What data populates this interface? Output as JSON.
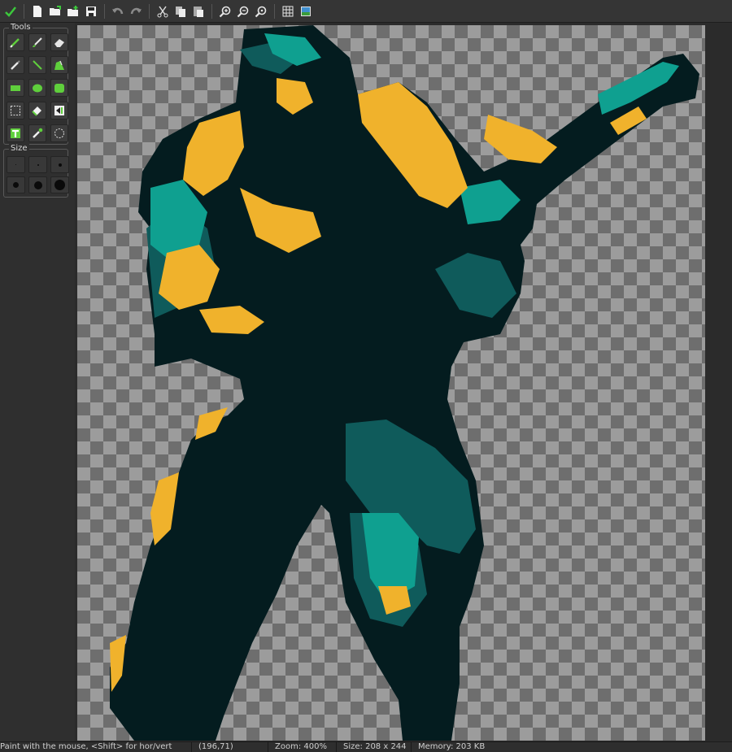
{
  "toolbar": {
    "buttons": [
      {
        "name": "apply-icon"
      },
      {
        "name": "new-file-icon"
      },
      {
        "name": "open-file-icon"
      },
      {
        "name": "open-recent-icon"
      },
      {
        "name": "save-icon"
      },
      {
        "name": "undo-icon"
      },
      {
        "name": "redo-icon"
      },
      {
        "name": "cut-icon"
      },
      {
        "name": "copy-icon"
      },
      {
        "name": "paste-icon"
      },
      {
        "name": "zoom-in-icon"
      },
      {
        "name": "zoom-out-icon"
      },
      {
        "name": "zoom-reset-icon"
      },
      {
        "name": "grid-icon"
      },
      {
        "name": "preview-icon"
      }
    ]
  },
  "tools_panel": {
    "title": "Tools",
    "tools": [
      "pencil",
      "brush",
      "eraser",
      "pen",
      "line",
      "fill",
      "rectangle",
      "ellipse",
      "rounded-rectangle",
      "select",
      "color-picker",
      "flip",
      "text",
      "dropper",
      "lasso"
    ]
  },
  "size_panel": {
    "title": "Size"
  },
  "colors": {
    "dark": "#041c1f",
    "teal": "#0f5b5b",
    "cyan": "#0fa090",
    "gold": "#f0b22c"
  },
  "statusbar": {
    "hint": "Paint with the mouse, <Shift> for hor/vert",
    "coords": "(196,71)",
    "zoom": "Zoom: 400%",
    "size": "Size: 208 x 244",
    "memory": "Memory: 203 KB"
  }
}
